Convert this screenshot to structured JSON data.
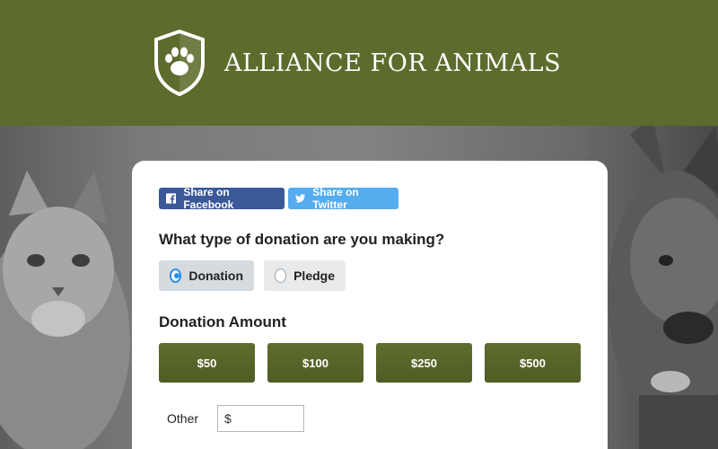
{
  "header": {
    "brand_name": "ALLIANCE FOR ANIMALS",
    "logo_icon": "shield-paw-icon",
    "background_color": "#5d6b2c"
  },
  "share": {
    "facebook_label": "Share on Facebook",
    "facebook_icon": "facebook-icon",
    "facebook_color": "#3b5998",
    "twitter_label": "Share on Twitter",
    "twitter_icon": "twitter-icon",
    "twitter_color": "#55acee"
  },
  "donation_type": {
    "question": "What type of donation are you making?",
    "options": [
      {
        "label": "Donation",
        "selected": true
      },
      {
        "label": "Pledge",
        "selected": false
      }
    ]
  },
  "amount": {
    "title": "Donation Amount",
    "options": [
      "$50",
      "$100",
      "$250",
      "$500"
    ],
    "button_color": "#5a6829"
  },
  "other": {
    "label": "Other",
    "currency_symbol": "$",
    "value": ""
  },
  "accent_color": "#2b8fe6"
}
